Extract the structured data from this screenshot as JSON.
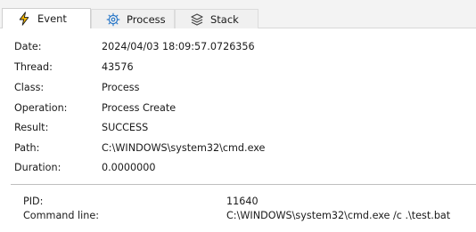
{
  "tabs": [
    {
      "label": "Event",
      "icon": "lightning-icon",
      "active": true
    },
    {
      "label": "Process",
      "icon": "gear-icon",
      "active": false
    },
    {
      "label": "Stack",
      "icon": "stack-layers-icon",
      "active": false
    }
  ],
  "properties": [
    {
      "label": "Date:",
      "value": "2024/04/03 18:09:57.0726356"
    },
    {
      "label": "Thread:",
      "value": "43576"
    },
    {
      "label": "Class:",
      "value": "Process"
    },
    {
      "label": "Operation:",
      "value": "Process Create"
    },
    {
      "label": "Result:",
      "value": "SUCCESS"
    },
    {
      "label": "Path:",
      "value": "C:\\WINDOWS\\system32\\cmd.exe"
    },
    {
      "label": "Duration:",
      "value": "0.0000000"
    }
  ],
  "details": [
    {
      "label": "PID:",
      "value": "11640"
    },
    {
      "label": "Command line:",
      "value": "C:\\WINDOWS\\system32\\cmd.exe /c .\\test.bat"
    }
  ],
  "colors": {
    "lightning": "#f2b500",
    "icon_blue": "#2a78c8",
    "icon_dark": "#444444"
  }
}
